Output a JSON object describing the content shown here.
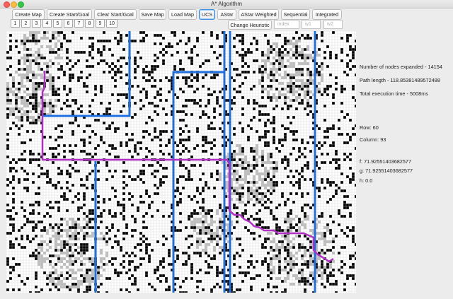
{
  "window": {
    "title": "A* Algorithm"
  },
  "toolbar": {
    "buttons": [
      {
        "label": "Create Map",
        "selected": false
      },
      {
        "label": "Create Start/Goal",
        "selected": false
      },
      {
        "label": "Clear Start/Goal",
        "selected": false
      },
      {
        "label": "Save Map",
        "selected": false
      },
      {
        "label": "Load Map",
        "selected": false
      },
      {
        "label": "UCS",
        "selected": true
      },
      {
        "label": "AStar",
        "selected": false
      },
      {
        "label": "AStar Weighted",
        "selected": false
      },
      {
        "label": "Sequential",
        "selected": false
      },
      {
        "label": "Integrated",
        "selected": false
      }
    ],
    "number_buttons": [
      "1",
      "2",
      "3",
      "4",
      "5",
      "6",
      "7",
      "8",
      "9",
      "10"
    ],
    "change_heuristic_label": "Change Heuristic",
    "fields": [
      {
        "placeholder": "index",
        "value": ""
      },
      {
        "placeholder": "w1",
        "value": ""
      },
      {
        "placeholder": "w2",
        "value": ""
      }
    ]
  },
  "stats": {
    "nodes_expanded": "Number of nodes expanded  - 14154",
    "path_length": "Path length - 118.85381489572488",
    "execution_time": "Total execution time - 5008ms",
    "row": "Row: 60",
    "column": "Column: 93",
    "f": "f: 71.92551403682577",
    "g": "g: 71.92551403682577",
    "h": "h: 0.0"
  },
  "map": {
    "colors": {
      "blocked": "#000000",
      "free": "#ffffff",
      "hard_to_traverse": "#bdbdbd",
      "highway": "#1f6fe0",
      "path": "#b02fc4",
      "grid_line": "#cfcfcf"
    }
  }
}
